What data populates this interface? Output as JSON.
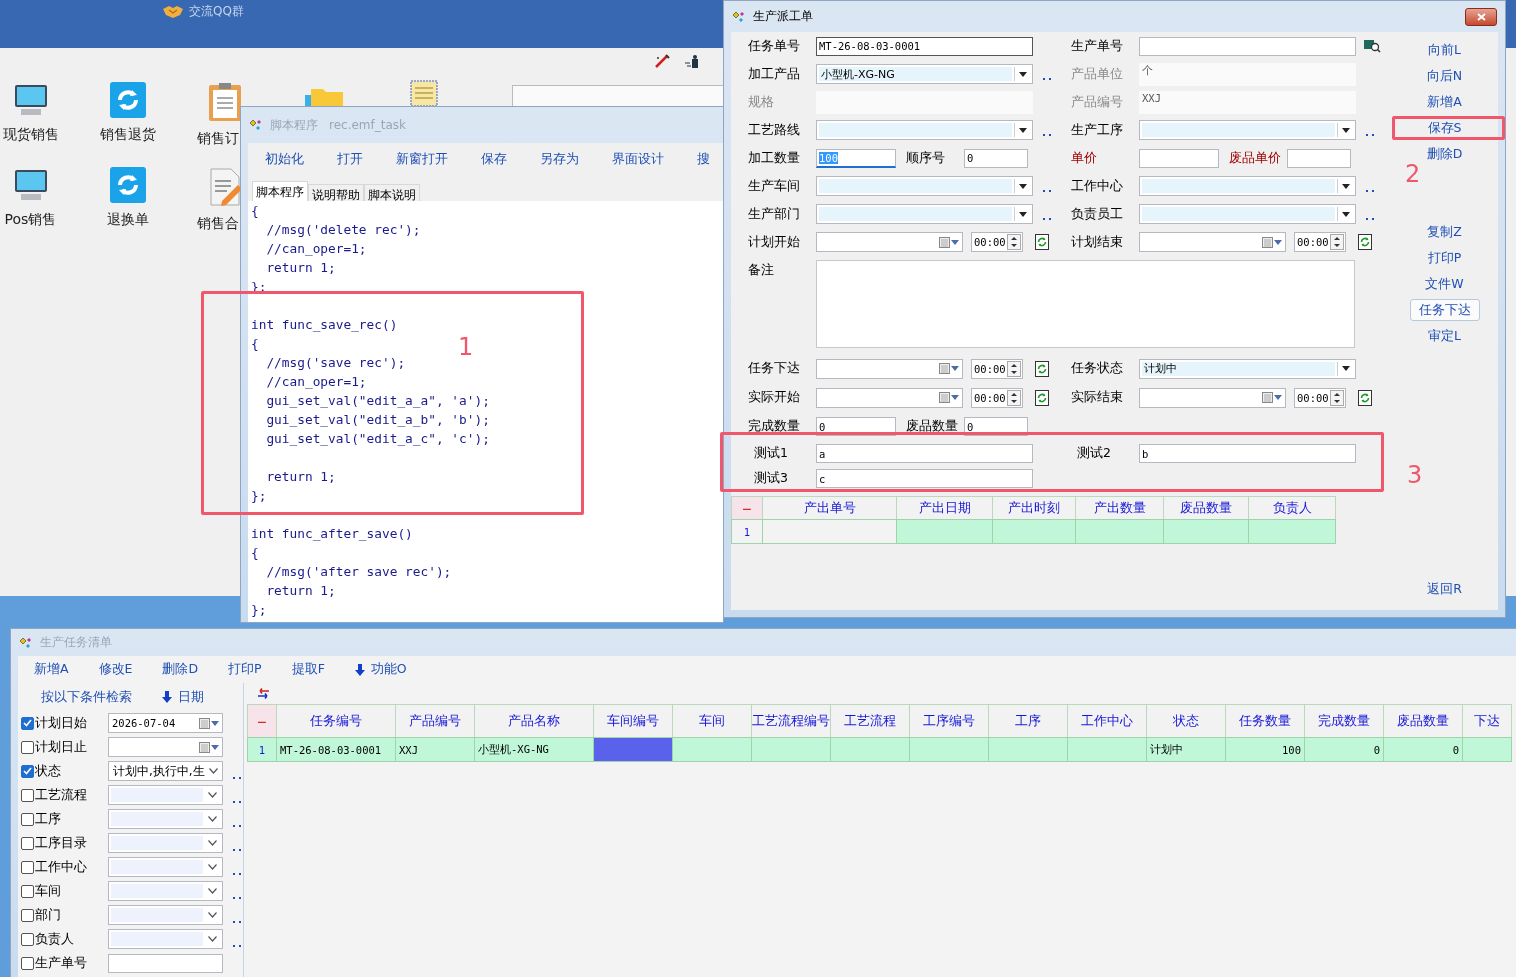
{
  "desktop": {
    "header_link": "交流QQ群",
    "shortcuts": [
      {
        "label": "现货销售",
        "kind": "monitor"
      },
      {
        "label": "销售退货",
        "kind": "refresh"
      },
      {
        "label": "销售订",
        "kind": "clipboard"
      },
      {
        "label": "Pos销售",
        "kind": "monitor"
      },
      {
        "label": "退换单",
        "kind": "refresh"
      },
      {
        "label": "销售合",
        "kind": "document"
      }
    ]
  },
  "script_window": {
    "title": "脚本程序",
    "file": "rec.emf_task",
    "toolbar": [
      "初始化",
      "打开",
      "新窗打开",
      "保存",
      "另存为",
      "界面设计",
      "搜"
    ],
    "tabs": [
      {
        "label": "脚本程序",
        "selected": true
      },
      {
        "label": "说明帮助",
        "selected": false
      },
      {
        "label": "脚本说明",
        "selected": false
      }
    ],
    "code": [
      {
        "kind": "line",
        "text": "{"
      },
      {
        "kind": "line",
        "text": "  //msg('delete rec');"
      },
      {
        "kind": "line",
        "text": "  //can_oper=1;"
      },
      {
        "kind": "line",
        "text": "  return 1;"
      },
      {
        "kind": "line",
        "text": "};"
      },
      {
        "kind": "blank"
      },
      {
        "kind": "line",
        "text": "int func_save_rec()"
      },
      {
        "kind": "line",
        "text": "{"
      },
      {
        "kind": "line",
        "text": "  //msg('save rec');"
      },
      {
        "kind": "line",
        "text": "  //can_oper=1;"
      },
      {
        "kind": "line",
        "text": "  gui_set_val(\"edit_a_a\", 'a');"
      },
      {
        "kind": "line",
        "text": "  gui_set_val(\"edit_a_b\", 'b');"
      },
      {
        "kind": "line",
        "text": "  gui_set_val(\"edit_a_c\", 'c');"
      },
      {
        "kind": "blank"
      },
      {
        "kind": "line",
        "text": "  return 1;"
      },
      {
        "kind": "line",
        "text": "};"
      },
      {
        "kind": "blank"
      },
      {
        "kind": "line",
        "text": "int func_after_save()"
      },
      {
        "kind": "line",
        "text": "{"
      },
      {
        "kind": "line",
        "text": "  //msg('after save rec');"
      },
      {
        "kind": "line",
        "text": "  return 1;"
      },
      {
        "kind": "line",
        "text": "};"
      }
    ]
  },
  "dispatch_form": {
    "title": "生产派工单",
    "rows": [
      {
        "cells": [
          {
            "label": "任务单号",
            "kind": "text",
            "value": "MT-26-08-03-0001",
            "disabled": false
          },
          {
            "label": "生产单号",
            "kind": "lookup",
            "disabled": false
          }
        ]
      },
      {
        "cells": [
          {
            "label": "加工产品",
            "kind": "combo",
            "value": "小型机-XG-NG",
            "more": true,
            "disabled": false
          },
          {
            "label": "产品单位",
            "kind": "readonly",
            "value": "个",
            "disabled": true
          }
        ]
      },
      {
        "cells": [
          {
            "label": "规格",
            "kind": "readonly",
            "disabled": true
          },
          {
            "label": "产品编号",
            "kind": "readonly",
            "value": "XXJ",
            "disabled": true
          }
        ]
      },
      {
        "cells": [
          {
            "label": "工艺路线",
            "kind": "combo",
            "more": true,
            "disabled": false
          },
          {
            "label": "生产工序",
            "kind": "combo",
            "more": true,
            "disabled": false
          }
        ]
      },
      {
        "cells": [
          {
            "kind": "split",
            "fields": [
              {
                "label": "加工数量",
                "value": "100",
                "focused": true,
                "required": false
              },
              {
                "label": "顺序号",
                "value": "0",
                "focused": false,
                "required": false
              }
            ]
          },
          {
            "kind": "split",
            "fields": [
              {
                "label": "单价",
                "focused": false,
                "required": true
              },
              {
                "label": "废品单价",
                "focused": false,
                "required": true
              }
            ]
          }
        ]
      },
      {
        "cells": [
          {
            "label": "生产车间",
            "kind": "combo",
            "more": true,
            "disabled": false
          },
          {
            "label": "工作中心",
            "kind": "combo",
            "more": true,
            "disabled": false
          }
        ]
      },
      {
        "cells": [
          {
            "label": "生产部门",
            "kind": "combo",
            "more": true,
            "disabled": false
          },
          {
            "label": "负责员工",
            "kind": "combo",
            "more": true,
            "disabled": false
          }
        ]
      },
      {
        "cells": [
          {
            "label": "计划开始",
            "kind": "date",
            "time": "00:00",
            "disabled": false
          },
          {
            "label": "计划结束",
            "kind": "date",
            "time": "00:00",
            "disabled": false
          }
        ]
      }
    ],
    "memo_label": "备注",
    "rows_after": [
      {
        "cells": [
          {
            "label": "任务下达",
            "kind": "date",
            "time": "00:00",
            "disabled": false
          },
          {
            "label": "任务状态",
            "kind": "combo",
            "value": "计划中",
            "more": false,
            "disabled": false
          }
        ]
      },
      {
        "cells": [
          {
            "label": "实际开始",
            "kind": "date",
            "time": "00:00",
            "disabled": false
          },
          {
            "label": "实际结束",
            "kind": "date",
            "time": "00:00",
            "disabled": false
          }
        ]
      },
      {
        "cells": [
          {
            "kind": "split",
            "fields": [
              {
                "label": "完成数量",
                "value": "0",
                "focused": false,
                "required": false
              },
              {
                "label": "废品数量",
                "value": "0",
                "focused": false,
                "required": false
              }
            ]
          }
        ]
      }
    ],
    "custom_rows": [
      {
        "cells": [
          {
            "label": "测试1",
            "value": "a"
          },
          {
            "label": "测试2",
            "value": "b"
          }
        ]
      },
      {
        "cells": [
          {
            "label": "测试3",
            "value": "c"
          }
        ]
      }
    ],
    "output_grid": {
      "marker": "−",
      "columns": [
        "产出单号",
        "产出日期",
        "产出时刻",
        "产出数量",
        "废品数量",
        "负责人"
      ],
      "rows": [
        {
          "number": "1"
        }
      ]
    },
    "nav_buttons": [
      "向前L",
      "向后N",
      "新增A",
      "保存S",
      "删除D"
    ],
    "action_buttons": [
      {
        "label": "复制Z",
        "kind": "link"
      },
      {
        "label": "打印P",
        "kind": "link"
      },
      {
        "label": "文件W",
        "kind": "link"
      },
      {
        "label": "任务下达",
        "kind": "button"
      },
      {
        "label": "审定L",
        "kind": "link"
      }
    ],
    "return_button": "返回R"
  },
  "task_list": {
    "title": "生产任务清单",
    "toolbar": [
      {
        "label": "新增A",
        "kind": "link"
      },
      {
        "label": "修改E",
        "kind": "link"
      },
      {
        "label": "删除D",
        "kind": "link"
      },
      {
        "label": "打印P",
        "kind": "link"
      },
      {
        "label": "提取F",
        "kind": "link"
      },
      {
        "label": "功能O",
        "kind": "menu"
      }
    ],
    "search_title": "按以下条件检索",
    "date_menu": "日期",
    "filters": [
      {
        "label": "计划日始",
        "checked": true,
        "kind": "date",
        "value": "2026-07-04"
      },
      {
        "label": "计划日止",
        "checked": false,
        "kind": "date"
      },
      {
        "label": "状态",
        "checked": true,
        "kind": "combo",
        "value": "计划中,执行中,生"
      },
      {
        "label": "工艺流程",
        "checked": false,
        "kind": "combo"
      },
      {
        "label": "工序",
        "checked": false,
        "kind": "combo"
      },
      {
        "label": "工序目录",
        "checked": false,
        "kind": "combo"
      },
      {
        "label": "工作中心",
        "checked": false,
        "kind": "combo"
      },
      {
        "label": "车间",
        "checked": false,
        "kind": "combo"
      },
      {
        "label": "部门",
        "checked": false,
        "kind": "combo"
      },
      {
        "label": "负责人",
        "checked": false,
        "kind": "combo"
      },
      {
        "label": "生产单号",
        "checked": false,
        "kind": "text"
      }
    ],
    "marker": "−",
    "columns": [
      {
        "label": "任务编号",
        "kind": "text"
      },
      {
        "label": "产品编号",
        "kind": "text"
      },
      {
        "label": "产品名称",
        "kind": "text"
      },
      {
        "label": "车间编号",
        "kind": "text"
      },
      {
        "label": "车间",
        "kind": "text"
      },
      {
        "label": "工艺流程编号",
        "kind": "text"
      },
      {
        "label": "工艺流程",
        "kind": "text"
      },
      {
        "label": "工序编号",
        "kind": "text"
      },
      {
        "label": "工序",
        "kind": "text"
      },
      {
        "label": "工作中心",
        "kind": "text"
      },
      {
        "label": "状态",
        "kind": "text"
      },
      {
        "label": "任务数量",
        "kind": "number"
      },
      {
        "label": "完成数量",
        "kind": "number"
      },
      {
        "label": "废品数量",
        "kind": "number"
      },
      {
        "label": "下达",
        "kind": "text"
      }
    ],
    "rows": [
      {
        "number": "1",
        "cells": [
          {
            "text": "MT-26-08-03-0001",
            "selected": false
          },
          {
            "text": "XXJ",
            "selected": false
          },
          {
            "text": "小型机-XG-NG",
            "selected": false
          },
          {
            "selected": true
          },
          {
            "selected": false
          },
          {
            "selected": false
          },
          {
            "selected": false
          },
          {
            "selected": false
          },
          {
            "selected": false
          },
          {
            "selected": false
          },
          {
            "text": "计划中",
            "selected": false
          },
          {
            "text": "100",
            "selected": false
          },
          {
            "text": "0",
            "selected": false
          },
          {
            "text": "0",
            "selected": false
          },
          {
            "selected": false
          }
        ]
      }
    ]
  },
  "annotations": [
    "1",
    "2",
    "3"
  ]
}
